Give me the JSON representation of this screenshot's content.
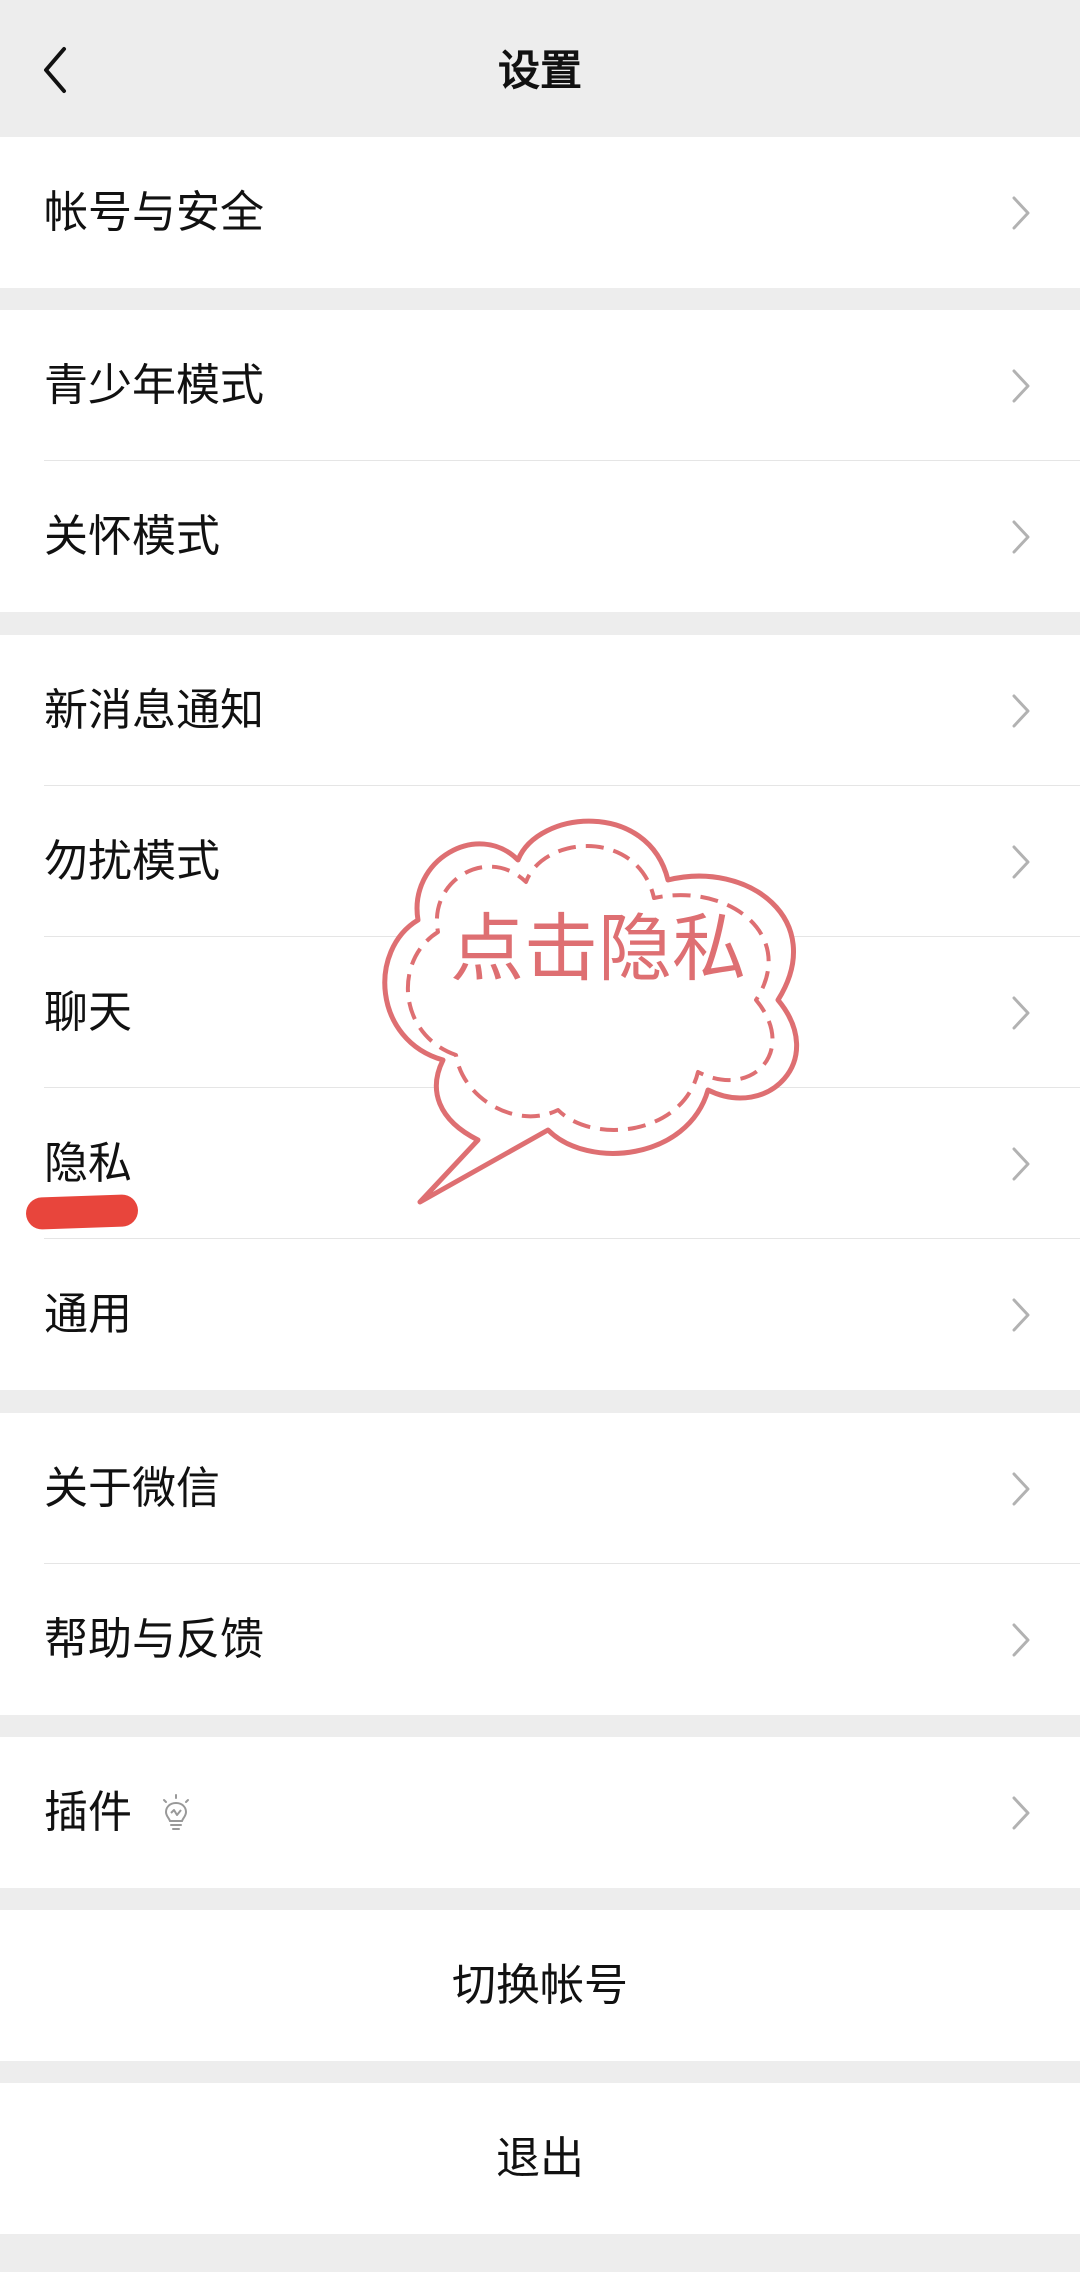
{
  "header": {
    "title": "设置"
  },
  "groups": [
    {
      "items": [
        "帐号与安全"
      ]
    },
    {
      "items": [
        "青少年模式",
        "关怀模式"
      ]
    },
    {
      "items": [
        "新消息通知",
        "勿扰模式",
        "聊天",
        "隐私",
        "通用"
      ]
    },
    {
      "items": [
        "关于微信",
        "帮助与反馈"
      ]
    },
    {
      "items": [
        "插件"
      ]
    }
  ],
  "actions": {
    "switch_account": "切换帐号",
    "logout": "退出"
  },
  "annotation": {
    "bubble_text": "点击隐私"
  },
  "icons": {
    "back": "chevron-left-icon",
    "chevron": "chevron-right-icon",
    "plugin": "lightbulb-icon"
  },
  "colors": {
    "bubble": "#de6f72",
    "highlight": "#e8453c",
    "background": "#ededed"
  }
}
